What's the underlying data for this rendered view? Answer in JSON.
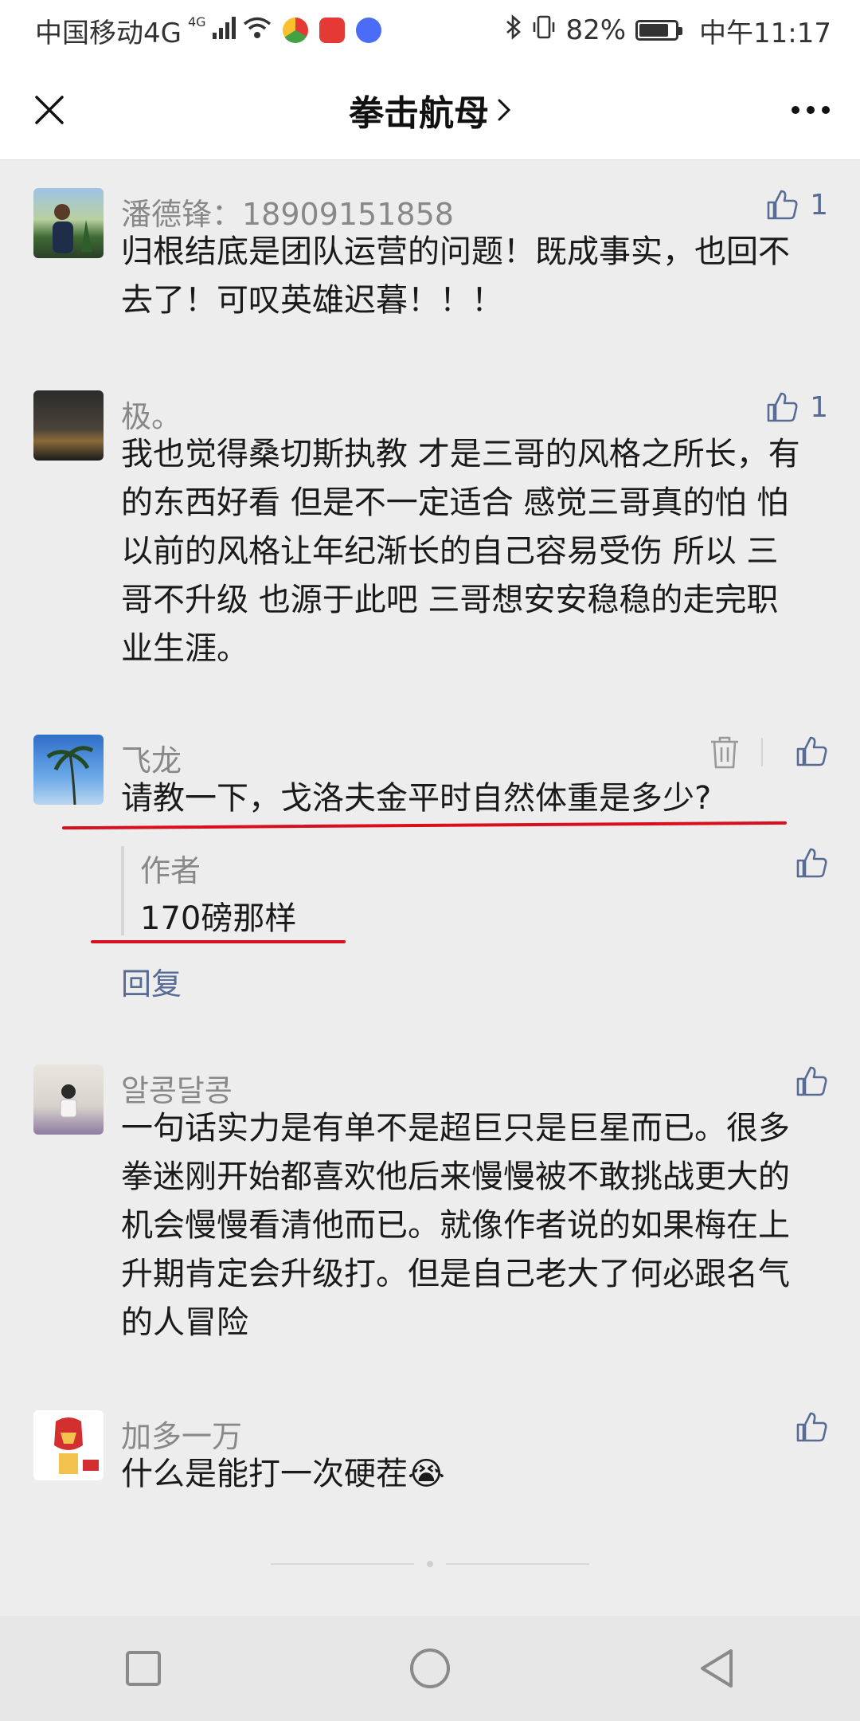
{
  "status_bar": {
    "carrier": "中国移动4G",
    "signal_badge": "4G",
    "battery_percent": "82%",
    "battery_level": 0.82,
    "time": "中午11:17"
  },
  "header": {
    "title": "拳击航母"
  },
  "comments": [
    {
      "name": "潘德锋：18909151858",
      "text": "归根结底是团队运营的问题！既成事实，也回不去了！可叹英雄迟暮！！！",
      "likes": "1"
    },
    {
      "name": "极。",
      "text": "我也觉得桑切斯执教 才是三哥的风格之所长，有的东西好看  但是不一定适合  感觉三哥真的怕  怕以前的风格让年纪渐长的自己容易受伤   所以  三哥不升级   也源于此吧   三哥想安安稳稳的走完职业生涯。",
      "likes": "1"
    },
    {
      "name": "飞龙",
      "text": "请教一下，戈洛夫金平时自然体重是多少?",
      "reply": {
        "author": "作者",
        "text": "170磅那样"
      },
      "reply_link": "回复"
    },
    {
      "name": "알콩달콩",
      "text": "一句话实力是有单不是超巨只是巨星而已。很多拳迷刚开始都喜欢他后来慢慢被不敢挑战更大的机会慢慢看清他而已。就像作者说的如果梅在上升期肯定会升级打。但是自己老大了何必跟名气的人冒险"
    },
    {
      "name": "加多一万",
      "text": "什么是能打一次硬茬",
      "emoji": "😭"
    }
  ],
  "colors": {
    "link": "#576b95",
    "annotation": "#d8101e",
    "background": "#ededed"
  }
}
